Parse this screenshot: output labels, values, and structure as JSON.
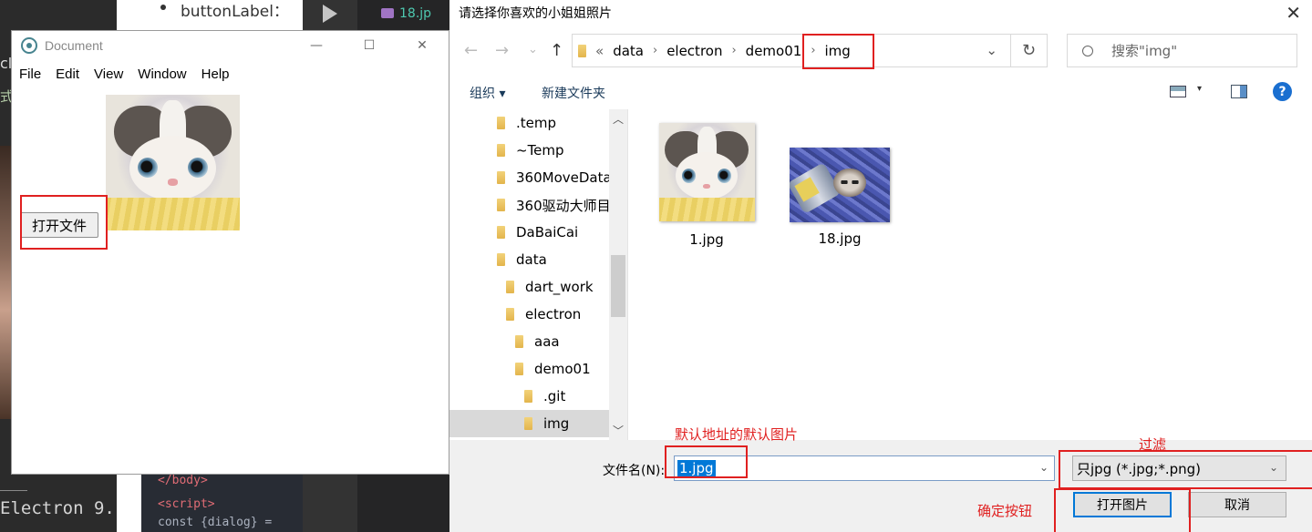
{
  "background": {
    "bullet_label": "buttonLabel：",
    "editor_file": "18.jp",
    "cut_text_1": "cl",
    "cut_text_2": "式[",
    "code_line_1": "</body>",
    "code_line_2": "<script>",
    "code_line_3": "  const {dialog} =",
    "bottom_text": "Electron 9."
  },
  "doc_window": {
    "title": "Document",
    "menu": [
      "File",
      "Edit",
      "View",
      "Window",
      "Help"
    ],
    "open_button": "打开文件",
    "controls": {
      "minimize": "—",
      "maximize": "☐",
      "close": "✕"
    }
  },
  "dialog": {
    "title": "请选择你喜欢的小姐姐照片",
    "nav": {
      "back": "←",
      "forward": "→",
      "recent": "⌄",
      "up": "↑"
    },
    "breadcrumb": [
      "data",
      "electron",
      "demo01",
      "img"
    ],
    "breadcrumb_prefix": "«",
    "search_placeholder": "搜索\"img\"",
    "toolbar": {
      "organize": "组织 ▾",
      "new_folder": "新建文件夹",
      "help": "?"
    },
    "tree": [
      {
        "label": ".temp",
        "indent": 0
      },
      {
        "label": "~Temp",
        "indent": 0
      },
      {
        "label": "360MoveData",
        "indent": 0
      },
      {
        "label": "360驱动大师目",
        "indent": 0
      },
      {
        "label": "DaBaiCai",
        "indent": 0
      },
      {
        "label": "data",
        "indent": 0
      },
      {
        "label": "dart_work",
        "indent": 1
      },
      {
        "label": "electron",
        "indent": 1
      },
      {
        "label": "aaa",
        "indent": 2
      },
      {
        "label": "demo01",
        "indent": 2
      },
      {
        "label": ".git",
        "indent": 3
      },
      {
        "label": "img",
        "indent": 3,
        "selected": true
      }
    ],
    "files": [
      {
        "name": "1.jpg"
      },
      {
        "name": "18.jpg"
      }
    ],
    "filename_label": "文件名(N):",
    "filename_value": "1.jpg",
    "filter_value": "只jpg (*.jpg;*.png)",
    "open_button": "打开图片",
    "cancel_button": "取消",
    "close": "✕"
  },
  "annotations": {
    "default_path": "默认地址的默认图片",
    "filter": "过滤",
    "confirm": "确定按钮"
  },
  "colors": {
    "annotation": "#e02020",
    "selection": "#0078d7"
  }
}
